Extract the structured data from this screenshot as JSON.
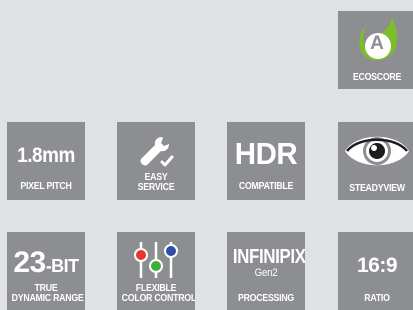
{
  "tiles": {
    "eco": {
      "letter": "A",
      "caption": "ECOSCORE"
    },
    "pitch": {
      "value": "1.8mm",
      "caption": "PIXEL PITCH"
    },
    "service": {
      "line1": "EASY",
      "line2": "SERVICE"
    },
    "hdr": {
      "value": "HDR",
      "caption": "COMPATIBLE"
    },
    "steady": {
      "caption": "STEADYVIEW"
    },
    "bit": {
      "value": "23",
      "suffix": "-BIT",
      "line1": "TRUE",
      "line2": "DYNAMIC RANGE"
    },
    "color": {
      "line1": "FLEXIBLE",
      "line2": "COLOR CONTROL"
    },
    "infini": {
      "value": "INFINIPIX",
      "sub": "Gen2",
      "caption": "PROCESSING"
    },
    "ratio": {
      "value": "16:9",
      "caption": "RATIO"
    }
  },
  "colors": {
    "tile_bg": "#8c8e91",
    "page_bg": "#dfe1e4",
    "eco_green": "#7cbd2a",
    "slider_red": "#e5372c",
    "slider_green": "#3fae3a",
    "slider_blue": "#2b4fa2"
  },
  "icons": {
    "eco": "leaf-icon",
    "service": "wrench-check-icon",
    "steady": "eye-icon",
    "color": "color-sliders-icon"
  }
}
